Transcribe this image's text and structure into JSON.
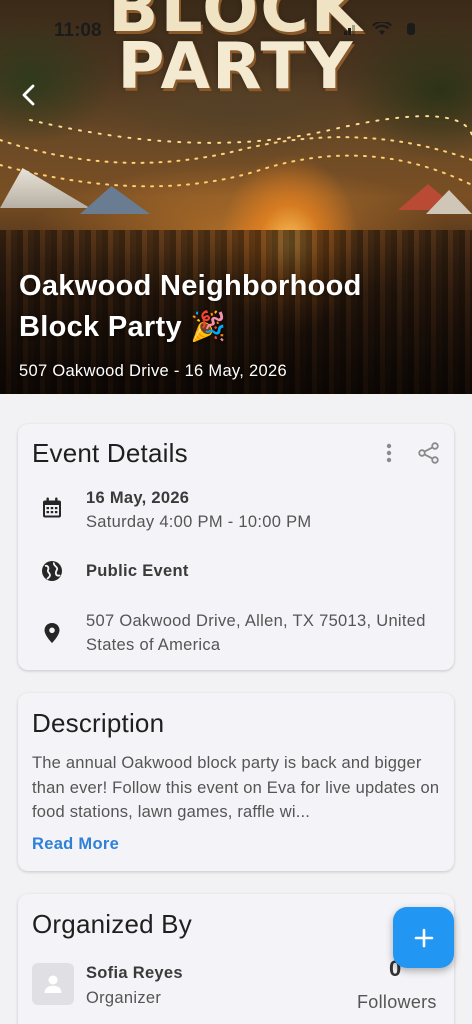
{
  "status_bar": {
    "time": "11:08"
  },
  "hero": {
    "poster_line1": "BLOCK",
    "poster_line2": "PARTY",
    "event_name": "Oakwood Neighborhood Block Party 🎉",
    "subtitle": "507 Oakwood Drive - 16 May, 2026"
  },
  "event_details": {
    "title": "Event Details",
    "date": "16 May, 2026",
    "time": "Saturday 4:00 PM - 10:00 PM",
    "visibility": "Public Event",
    "address": "507 Oakwood Drive, Allen, TX 75013, United States of America"
  },
  "description": {
    "title": "Description",
    "text": "The annual Oakwood block party is back and bigger than ever! Follow this event on Eva for live updates on food stations, lawn games, raffle wi...",
    "read_more": "Read More"
  },
  "organizer": {
    "title": "Organized By",
    "name": "Sofia Reyes",
    "role": "Organizer",
    "followers_count": "0",
    "followers_label": "Followers"
  },
  "colors": {
    "accent": "#2196f3",
    "link": "#2f80d6"
  },
  "icons": [
    "back-chevron-icon",
    "more-vertical-icon",
    "share-icon",
    "calendar-icon",
    "globe-icon",
    "location-pin-icon",
    "person-icon",
    "plus-icon"
  ]
}
